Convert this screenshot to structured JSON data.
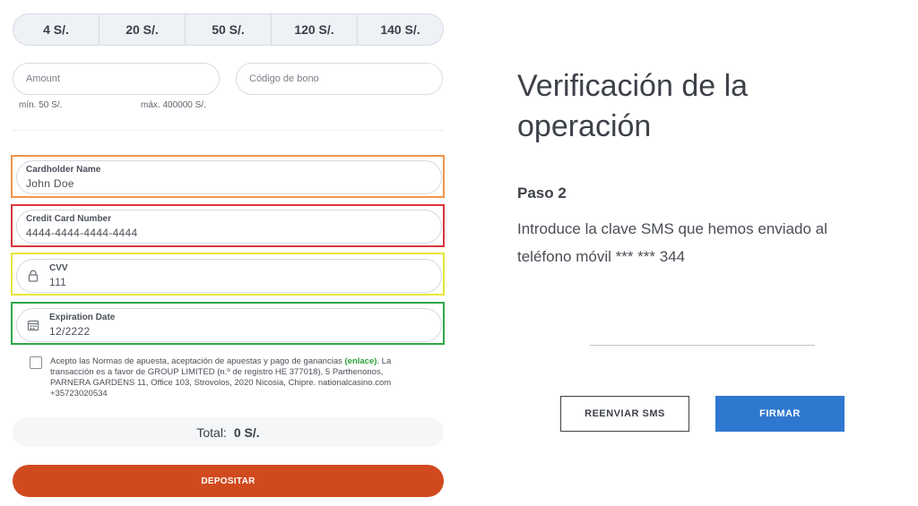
{
  "payment": {
    "amount_options": [
      "4 S/.",
      "20 S/.",
      "50 S/.",
      "120 S/.",
      "140 S/."
    ],
    "amount_placeholder": "Amount",
    "bonus_placeholder": "Código de bono",
    "min_label": "mín. 50 S/.",
    "max_label": "máx. 400000 S/.",
    "cardholder": {
      "label": "Cardholder Name",
      "value": "John Doe",
      "highlight": "#f0954a"
    },
    "card_number": {
      "label": "Credit Card Number",
      "value": "4444-4444-4444-4444",
      "highlight": "#d9363e"
    },
    "cvv": {
      "label": "CVV",
      "value": "111",
      "icon": "lock-icon",
      "highlight": "#e6e63a"
    },
    "expiration": {
      "label": "Expiration Date",
      "value": "12/2222",
      "icon": "calendar-icon",
      "highlight": "#2ea84a"
    },
    "terms_prefix": "Acepto las Normas de apuesta, aceptación de apuestas y pago de ganancias",
    "terms_link": "(enlace)",
    "terms_suffix": ". La transacción es a favor de GROUP LIMITED (n.º de registro HE 377018), 5 Parthenonos, PARNERA GARDENS 11, Office 103, Strovolos, 2020 Nicosia, Chipre. nationalcasino.com +35723020534",
    "total_label": "Total:",
    "total_value": "0 S/.",
    "deposit_label": "DEPOSITAR"
  },
  "verification": {
    "title": "Verificación de la operación",
    "step": "Paso 2",
    "description": "Introduce la clave SMS que hemos enviado al teléfono móvil *** *** 344",
    "resend_label": "REENVIAR SMS",
    "sign_label": "FIRMAR"
  },
  "colors": {
    "deposit": "#d14a1f",
    "sign": "#2f78d0",
    "link": "#2d9d3a"
  }
}
